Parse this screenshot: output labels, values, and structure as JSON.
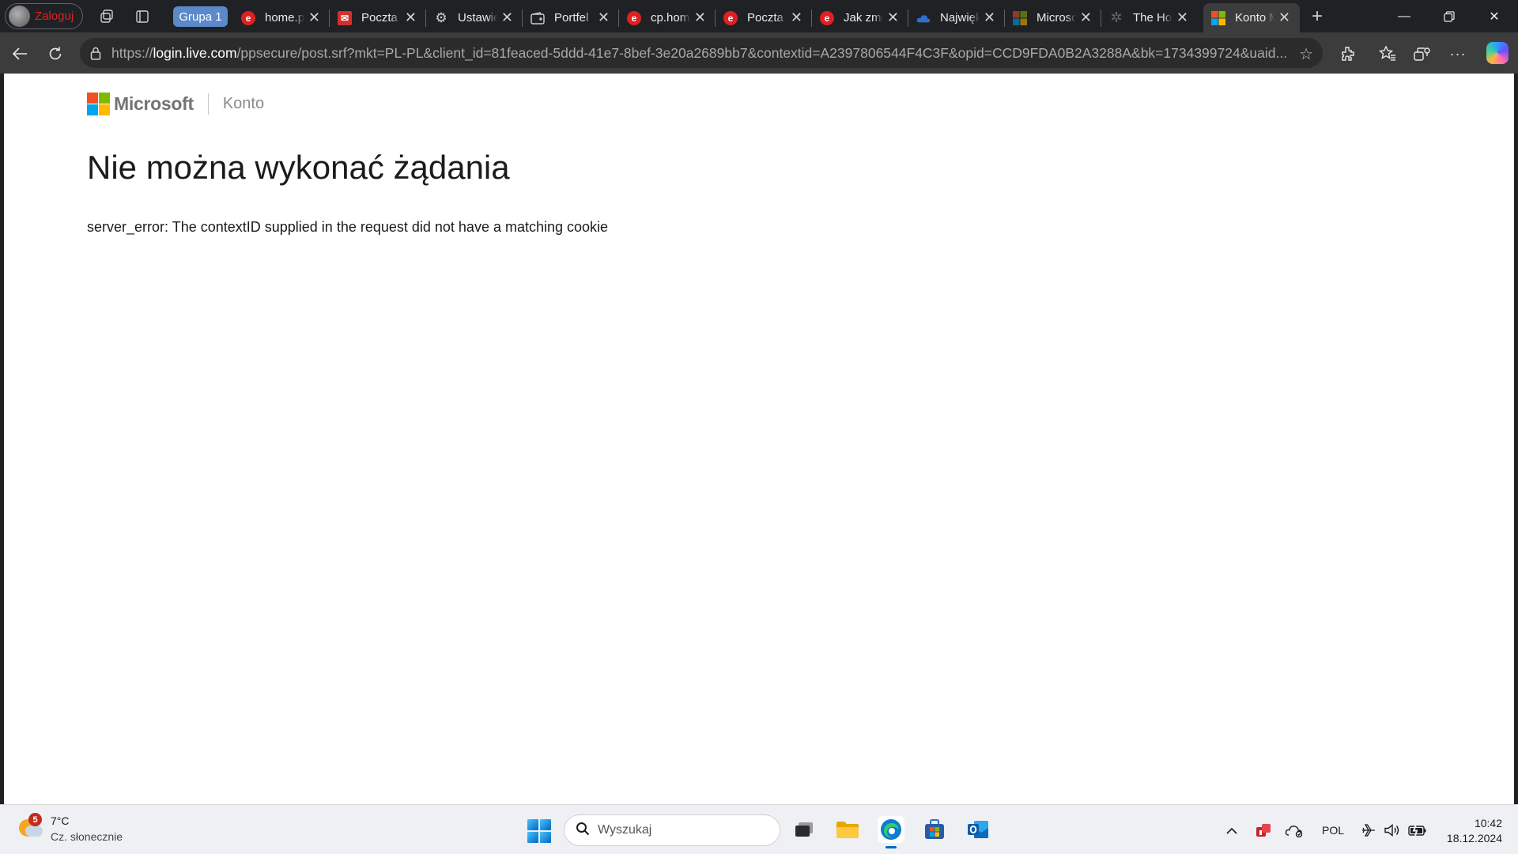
{
  "browser": {
    "profile_label": "Zaloguj",
    "group_label": "Grupa 1",
    "tabs": [
      {
        "title": "home.pl",
        "icon": "home-pl-favicon-icon",
        "color": "#e02020"
      },
      {
        "title": "Poczta",
        "icon": "mail-favicon-icon",
        "color": "#d32f2f"
      },
      {
        "title": "Ustawienia",
        "icon": "gear-icon",
        "color": "#d0d0d0"
      },
      {
        "title": "Portfel",
        "icon": "wallet-icon",
        "color": "#d0d0d0"
      },
      {
        "title": "cp.home.pl",
        "icon": "home-pl-favicon-icon",
        "color": "#e02020"
      },
      {
        "title": "Poczta",
        "icon": "home-pl-favicon-icon",
        "color": "#e02020"
      },
      {
        "title": "Jak zmienić",
        "icon": "home-pl-favicon-icon",
        "color": "#e02020"
      },
      {
        "title": "Największe",
        "icon": "onedrive-icon",
        "color": "#2f6fcf"
      },
      {
        "title": "Microsoft",
        "icon": "microsoft-logo-icon",
        "color": "#7f7f7f"
      },
      {
        "title": "The Home",
        "icon": "puzzle-favicon-icon",
        "color": "#5f6368"
      },
      {
        "title": "Konto Microsoft",
        "icon": "microsoft-logo-icon",
        "color": "#ffffff"
      }
    ],
    "url_scheme": "https://",
    "url_host": "login.live.com",
    "url_rest": "/ppsecure/post.srf?mkt=PL-PL&client_id=81feaced-5ddd-41e7-8bef-3e20a2689bb7&contextid=A2397806544F4C3F&opid=CCD9FDA0B2A3288A&bk=1734399724&uaid..."
  },
  "page": {
    "brand": "Microsoft",
    "section": "Konto",
    "title": "Nie można wykonać żądania",
    "message": "server_error: The contextID supplied in the request did not have a matching cookie"
  },
  "taskbar": {
    "weather_temp": "7°C",
    "weather_desc": "Cz. słonecznie",
    "weather_badge": "5",
    "search_placeholder": "Wyszukaj",
    "language": "POL",
    "time": "10:42",
    "date": "18.12.2024"
  },
  "colors": {
    "accent": "#5b89c9",
    "error_red": "#e02020",
    "taskbar_indicator": "#0067c0"
  }
}
